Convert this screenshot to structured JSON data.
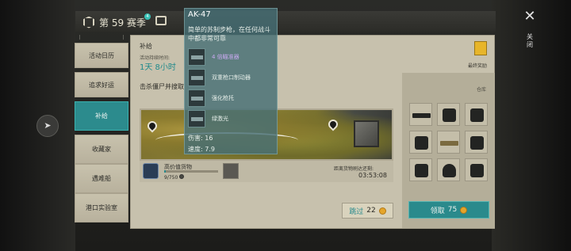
{
  "season": {
    "label": "第 59 赛季",
    "badge": "4"
  },
  "sidebar": {
    "items": [
      {
        "label": "活动日历"
      },
      {
        "label": "追求好运"
      },
      {
        "label": "补给",
        "active": true
      },
      {
        "label": "收藏家"
      },
      {
        "label": "遇难船"
      },
      {
        "label": "港口实验室"
      }
    ]
  },
  "panel": {
    "title": "补给",
    "event_label": "活动持续时间:",
    "event_time": "1天 8小时",
    "subline": "击杀僵尸并搜取"
  },
  "cargo": {
    "name": "高价值货物",
    "progress": "9/750",
    "progress_fraction": 0.012,
    "distance_label": "距离货物刷达还剩:",
    "distance_value": "03:53:08"
  },
  "skip_button": {
    "label": "跳过",
    "cost": "22"
  },
  "warehouse": {
    "label": "仓库",
    "items": [
      "rifle",
      "boots",
      "boots",
      "vest",
      "rifle-tan",
      "boots",
      "boots",
      "helmet",
      "boots"
    ]
  },
  "claim_button": {
    "label": "领取",
    "cost": "75"
  },
  "reward": {
    "label": "最终奖励"
  },
  "close": {
    "label": "关闭"
  },
  "tooltip": {
    "title": "AK-47",
    "desc": "简单的苏制步枪，在任何战斗中都非常可靠",
    "attachments": [
      {
        "name": "4 倍瞄准器",
        "color": "#c9a9f0"
      },
      {
        "name": "双重枪口制动器",
        "color": "#e6eee9"
      },
      {
        "name": "强化枪托",
        "color": "#e6eee9"
      },
      {
        "name": "绿激光",
        "color": "#e6eee9"
      }
    ],
    "damage": "伤害: 16",
    "speed": "速度: 7.9"
  },
  "colors": {
    "accent": "#2a8a8c",
    "coin": "#e5a52a",
    "panel": "#c7c1ad"
  }
}
